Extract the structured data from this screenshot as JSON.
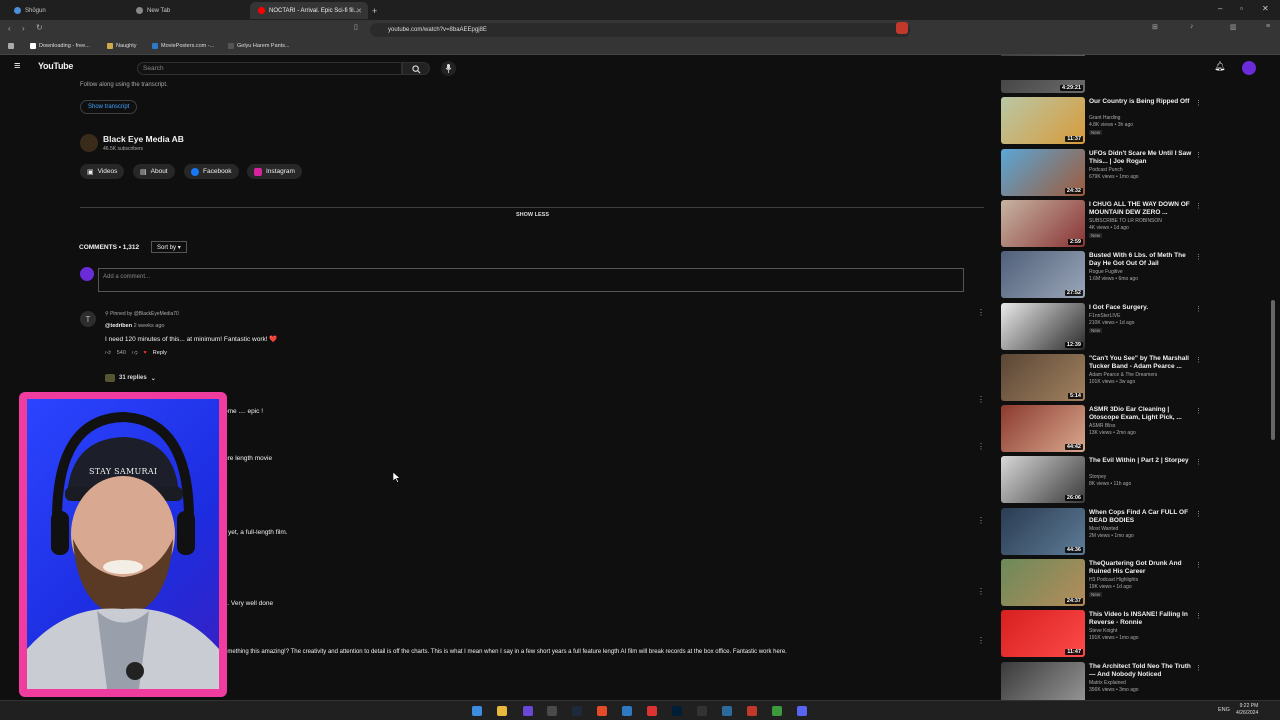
{
  "browser": {
    "tabs": [
      {
        "label": "Shōgun",
        "color": "#4a90d9"
      },
      {
        "label": "New Tab",
        "color": "#888888"
      },
      {
        "label": "NOCTARI - Arrival. Epic Sci-fi fil...",
        "color": "#ff0000"
      }
    ],
    "url": "youtube.com/watch?v=8baAEEpgj8E",
    "bookmarks": [
      "Downloading - free...",
      "Naughty",
      "MoviePosters.com -...",
      "Gelyu Harem Pants..."
    ]
  },
  "youtube": {
    "logo_text": "YouTube",
    "search_placeholder": "Search",
    "transcript_hint": "Follow along using the transcript.",
    "show_transcript": "Show transcript",
    "channel": {
      "name": "Black Eye Media AB",
      "subscribers": "46.5K subscribers"
    },
    "channel_links": [
      "Videos",
      "About",
      "Facebook",
      "Instagram"
    ],
    "show_less": "SHOW LESS",
    "comments_header": "COMMENTS • 1,312",
    "sort_by": "Sort by",
    "add_comment": "Add a comment...",
    "pinned_comment": {
      "avatar_letter": "T",
      "pinned_by": "Pinned by @BlackEyeMedia70",
      "author": "@tedriben",
      "time": "2 weeks ago",
      "text": "I need 120 minutes of this... at minimum! Fantastic work! ❤️",
      "likes": "540",
      "reply": "Reply",
      "replies": "31 replies"
    },
    "visible_comment_fragments": [
      "ome .... epic !",
      "ure length movie",
      "r yet, a full-length film.",
      "s. Very well done",
      "omething this amazing!? The creativity and attention to detail is off the charts. This is what I mean when I say in a few short years a full feature length AI film will break records at the box office. Fantastic work here."
    ],
    "recommendations": [
      {
        "title": "",
        "channel": "",
        "meta": "",
        "duration": "4:29:21",
        "colors": [
          "#3a3a3a",
          "#6b6b6b"
        ]
      },
      {
        "title": "Our Country is Being Ripped Off",
        "channel": "Grant Harding",
        "meta": "4.8K views • 3h ago",
        "duration": "11:37",
        "new": "New",
        "colors": [
          "#b9c7a6",
          "#d89b3a"
        ]
      },
      {
        "title": "UFOs Didn't Scare Me Until I Saw This... | Joe Rogan",
        "channel": "Podcast Punch",
        "meta": "679K views • 1mo ago",
        "duration": "24:32",
        "colors": [
          "#5aa7d6",
          "#9e5a3a"
        ]
      },
      {
        "title": "I CHUG ALL THE WAY DOWN OF MOUNTAIN DEW ZERO ...",
        "channel": "SUBSCRIBE TO LR ROBINSON",
        "meta": "4K views • 1d ago",
        "duration": "2:59",
        "new": "New",
        "colors": [
          "#c7b4a3",
          "#8a3434"
        ]
      },
      {
        "title": "Busted With 6 Lbs. of Meth The Day He Got Out Of Jail",
        "channel": "Rogue Fugitive",
        "meta": "1.6M views • 6mo ago",
        "duration": "27:52",
        "colors": [
          "#50607a",
          "#9aa6b8"
        ]
      },
      {
        "title": "I Got Face Surgery.",
        "channel": "F1nnSterLIVE",
        "meta": "210K views • 1d ago",
        "duration": "12:39",
        "new": "New",
        "colors": [
          "#eaeaea",
          "#2b2b2b"
        ]
      },
      {
        "title": "\"Can't You See\" by The Marshall Tucker Band - Adam Pearce ...",
        "channel": "Adam Pearce & The Dreamers",
        "meta": "101K views • 3w ago",
        "duration": "5:14",
        "colors": [
          "#5a4636",
          "#a2825f"
        ]
      },
      {
        "title": "ASMR 3Dio Ear Cleaning | Otoscope Exam, Light Pick, ...",
        "channel": "ASMR Bliss",
        "meta": "13K views • 2mo ago",
        "duration": "44:42",
        "colors": [
          "#8c3a2e",
          "#d9a88e"
        ]
      },
      {
        "title": "The Evil Within | Part 2 | Storpey",
        "channel": "Storpey",
        "meta": "8K views • 11h ago",
        "duration": "26:06",
        "colors": [
          "#d8d8d8",
          "#3a3a3a"
        ]
      },
      {
        "title": "When Cops Find A Car FULL OF DEAD BODIES",
        "channel": "Most Wanted",
        "meta": "2M views • 1mo ago",
        "duration": "44:36",
        "colors": [
          "#2a3c52",
          "#5e7b96"
        ]
      },
      {
        "title": "TheQuartering Got Drunk And Ruined His Career",
        "channel": "H3 Podcast Highlights",
        "meta": "19K views • 1d ago",
        "duration": "24:37",
        "new": "New",
        "colors": [
          "#6c8a5a",
          "#b58c5a"
        ]
      },
      {
        "title": "This Video Is INSANE! Falling In Reverse - Ronnie",
        "channel": "Steve Knight",
        "meta": "191K views • 1mo ago",
        "duration": "11:47",
        "colors": [
          "#d62020",
          "#ff4a4a"
        ]
      },
      {
        "title": "The Architect Told Neo The Truth — And Nobody Noticed",
        "channel": "Matrix Explained",
        "meta": "356K views • 3mo ago",
        "duration": "",
        "colors": [
          "#3a3a3a",
          "#9a9a9a"
        ]
      }
    ]
  },
  "webcam": {
    "cap_text": "STAY SAMURAI",
    "frame_color": "#f03c9e"
  },
  "taskbar": {
    "lang": "ENG",
    "time": "9:22 PM",
    "date": "4/26/2024"
  }
}
